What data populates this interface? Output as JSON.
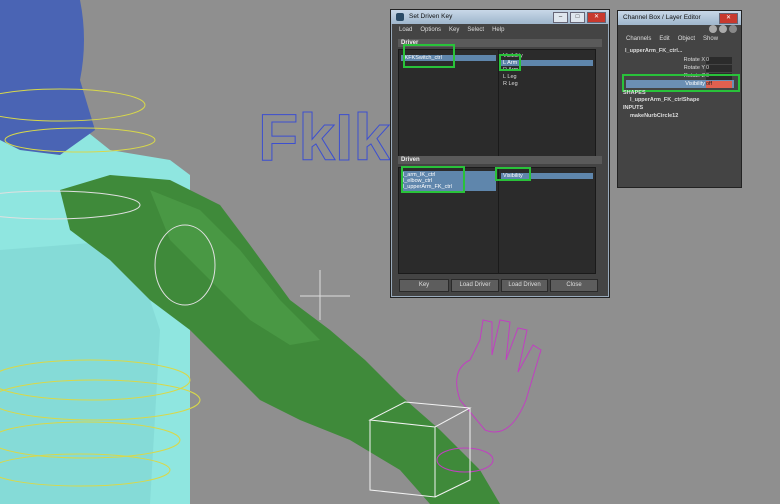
{
  "viewport": {
    "logo_text": "FkIk"
  },
  "set_driven_key": {
    "title": "Set Driven Key",
    "menu": [
      "Load",
      "Options",
      "Key",
      "Select",
      "Help"
    ],
    "driver_header": "Driver",
    "driver_objects": [
      "IKFKSwitch_ctrl"
    ],
    "driver_attributes": [
      "Visibility",
      "L Arm",
      "R Arm",
      "L Leg",
      "R Leg"
    ],
    "driven_header": "Driven",
    "driven_objects": [
      "l_arm_IK_ctrl",
      "l_elbow_ctrl",
      "l_upperArm_FK_ctrl"
    ],
    "driven_attributes": [
      "Visibility"
    ],
    "buttons": [
      "Key",
      "Load Driver",
      "Load Driven",
      "Close"
    ]
  },
  "channel_box": {
    "title": "Channel Box / Layer Editor",
    "menu": [
      "Channels",
      "Edit",
      "Object",
      "Show"
    ],
    "object_name": "l_upperArm_FK_ctrl...",
    "channels": [
      {
        "name": "Rotate X",
        "value": "0"
      },
      {
        "name": "Rotate Y",
        "value": "0"
      },
      {
        "name": "Rotate Z",
        "value": "0"
      },
      {
        "name": "Visibility",
        "value": "off"
      }
    ],
    "shapes_label": "SHAPES",
    "shape_name": "l_upperArm_FK_ctrlShape",
    "inputs_label": "INPUTS",
    "input_name": "makeNurbCircle12"
  },
  "colors": {
    "highlight": "#29c23a",
    "selection": "#5f86ac",
    "keyed_off": "#e0604f",
    "body_green": "#3f8a3a",
    "body_cyan": "#8fe6e0",
    "head_blue": "#4a64b4"
  }
}
